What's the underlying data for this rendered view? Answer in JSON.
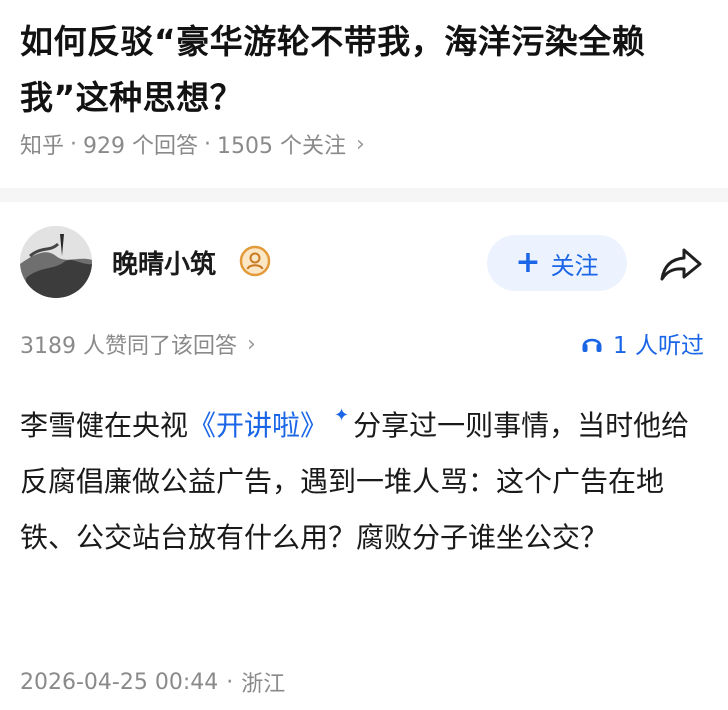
{
  "question": {
    "title": "如何反驳“豪华游轮不带我，海洋污染全赖我”这种思想？",
    "source": "知乎",
    "answer_count": "929 个回答",
    "follower_count": "1505 个关注",
    "separator": "·"
  },
  "author": {
    "name": "晚晴小筑",
    "follow_label": "关注",
    "follow_plus": "+"
  },
  "stats": {
    "votes": "3189 人赞同了该回答",
    "listeners": "1 人听过"
  },
  "answer": {
    "part1": "李雪健在央视",
    "program": "《开讲啦》",
    "spark": "✦",
    "part2": "分享过一则事情，当时他给反腐倡廉做公益广告，遇到一堆人骂：这个广告在地铁、公交站台放有什么用？腐败分子谁坐公交？"
  },
  "footer": {
    "datetime": "2026-04-25 00:44",
    "location": "浙江",
    "separator": "·"
  },
  "colors": {
    "accent": "#1a66e6",
    "muted": "#8a8a8a",
    "follow_bg": "#edf3fe"
  },
  "icons": {
    "meta_chevron": "chevron-right-icon",
    "share": "share-arrow-icon",
    "headphones": "headphones-icon",
    "badge": "user-badge-icon"
  }
}
